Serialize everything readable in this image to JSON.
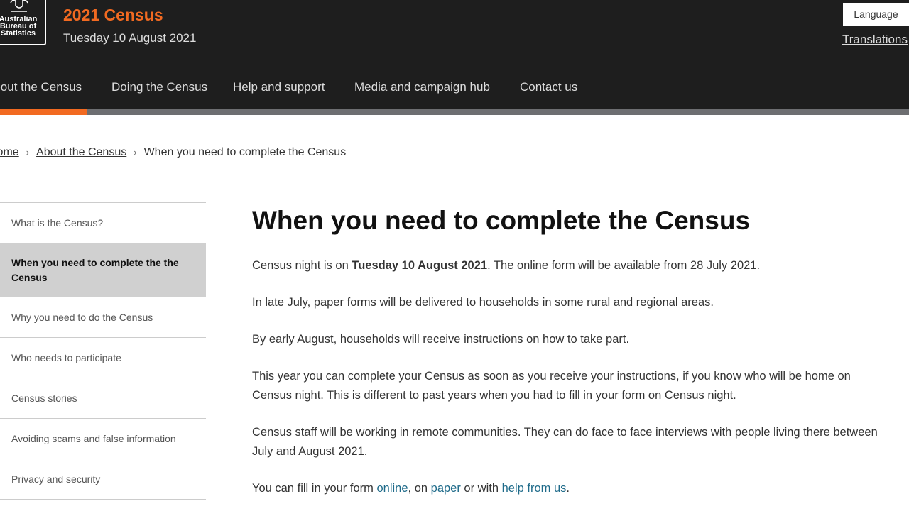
{
  "header": {
    "logo_text": "Australian Bureau of Statistics",
    "title": "2021 Census",
    "date": "Tuesday 10 August 2021",
    "language_button": "Language",
    "translations_link": "Translations"
  },
  "nav": {
    "items": [
      "About the Census",
      "Doing the Census",
      "Help and support",
      "Media and campaign hub",
      "Contact us"
    ],
    "active": "About the Census"
  },
  "breadcrumb": [
    "Home",
    "About the Census",
    "When you need to complete the Census"
  ],
  "sidebar": {
    "items": [
      "What is the Census?",
      "When you need to complete the the Census",
      "Why you need to do the Census",
      "Who needs to participate",
      "Census stories",
      "Avoiding scams and false information",
      "Privacy and security"
    ],
    "active_index": 1
  },
  "main": {
    "heading": "When you need to complete the Census",
    "p1": {
      "a": "Census night is on ",
      "b": "Tuesday 10 August 2021",
      "c": ". The online form will be available from 28 July 2021."
    },
    "p2": "In late July, paper forms will be delivered to households in some rural and regional areas.",
    "p3": "By early August, households will receive instructions on how to take part.",
    "p4": "This year you can complete your Census as soon as you receive your instructions, if you know who will be home on Census night. This is different to past years when you had to fill in your form on Census night.",
    "p5": "Census staff will be working in remote communities. They can do face to face interviews with people living there between July and August 2021.",
    "p6": {
      "a": "You can fill in your form ",
      "link1": "online",
      "b": ", on ",
      "link2": "paper",
      "c": " or with ",
      "link3": "help from us",
      "d": "."
    }
  },
  "colors": {
    "header_bg": "#1e1e1e",
    "accent": "#f26a21",
    "link": "#1f6b8a"
  }
}
